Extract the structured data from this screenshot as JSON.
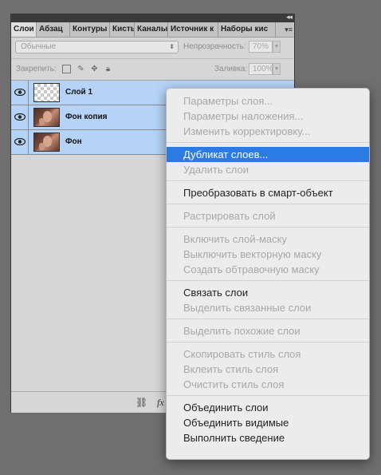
{
  "panel": {
    "tabs": [
      "Слои",
      "Абзац",
      "Контуры",
      "Кисть",
      "Каналы",
      "Источник к",
      "Наборы кис"
    ],
    "collapse_glyph": "◂◂",
    "menu_glyph": "▾≡",
    "blend_mode": "Обычные",
    "opacity_label": "Непрозрачность:",
    "opacity_value": "70%",
    "lock_label": "Закрепить:",
    "fill_label": "Заливка:",
    "fill_value": "100%"
  },
  "layers": [
    {
      "name": "Слой 1",
      "thumb": "transparent"
    },
    {
      "name": "Фон копия",
      "thumb": "photo"
    },
    {
      "name": "Фон",
      "thumb": "photo"
    }
  ],
  "context_menu": {
    "items": [
      {
        "label": "Параметры слоя...",
        "enabled": false
      },
      {
        "label": "Параметры наложения...",
        "enabled": false
      },
      {
        "label": "Изменить корректировку...",
        "enabled": false
      },
      {
        "label": "Дубликат слоев...",
        "enabled": true,
        "highlighted": true
      },
      {
        "label": "Удалить слои",
        "enabled": false
      },
      {
        "label": "Преобразовать в смарт-объект",
        "enabled": true
      },
      {
        "label": "Растрировать слой",
        "enabled": false
      },
      {
        "label": "Включить слой-маску",
        "enabled": false
      },
      {
        "label": "Выключить векторную маску",
        "enabled": false
      },
      {
        "label": "Создать обтравочную маску",
        "enabled": false
      },
      {
        "label": "Связать слои",
        "enabled": true
      },
      {
        "label": "Выделить связанные слои",
        "enabled": false
      },
      {
        "label": "Выделить похожие слои",
        "enabled": false
      },
      {
        "label": "Скопировать стиль слоя",
        "enabled": false
      },
      {
        "label": "Вклеить стиль слоя",
        "enabled": false
      },
      {
        "label": "Очистить стиль слоя",
        "enabled": false
      },
      {
        "label": "Объединить слои",
        "enabled": true
      },
      {
        "label": "Объединить видимые",
        "enabled": true
      },
      {
        "label": "Выполнить сведение",
        "enabled": true
      }
    ]
  },
  "colors": {
    "selection": "#b5d3f7",
    "menu_highlight": "#2a7ce4",
    "background": "#6f6f6f"
  }
}
